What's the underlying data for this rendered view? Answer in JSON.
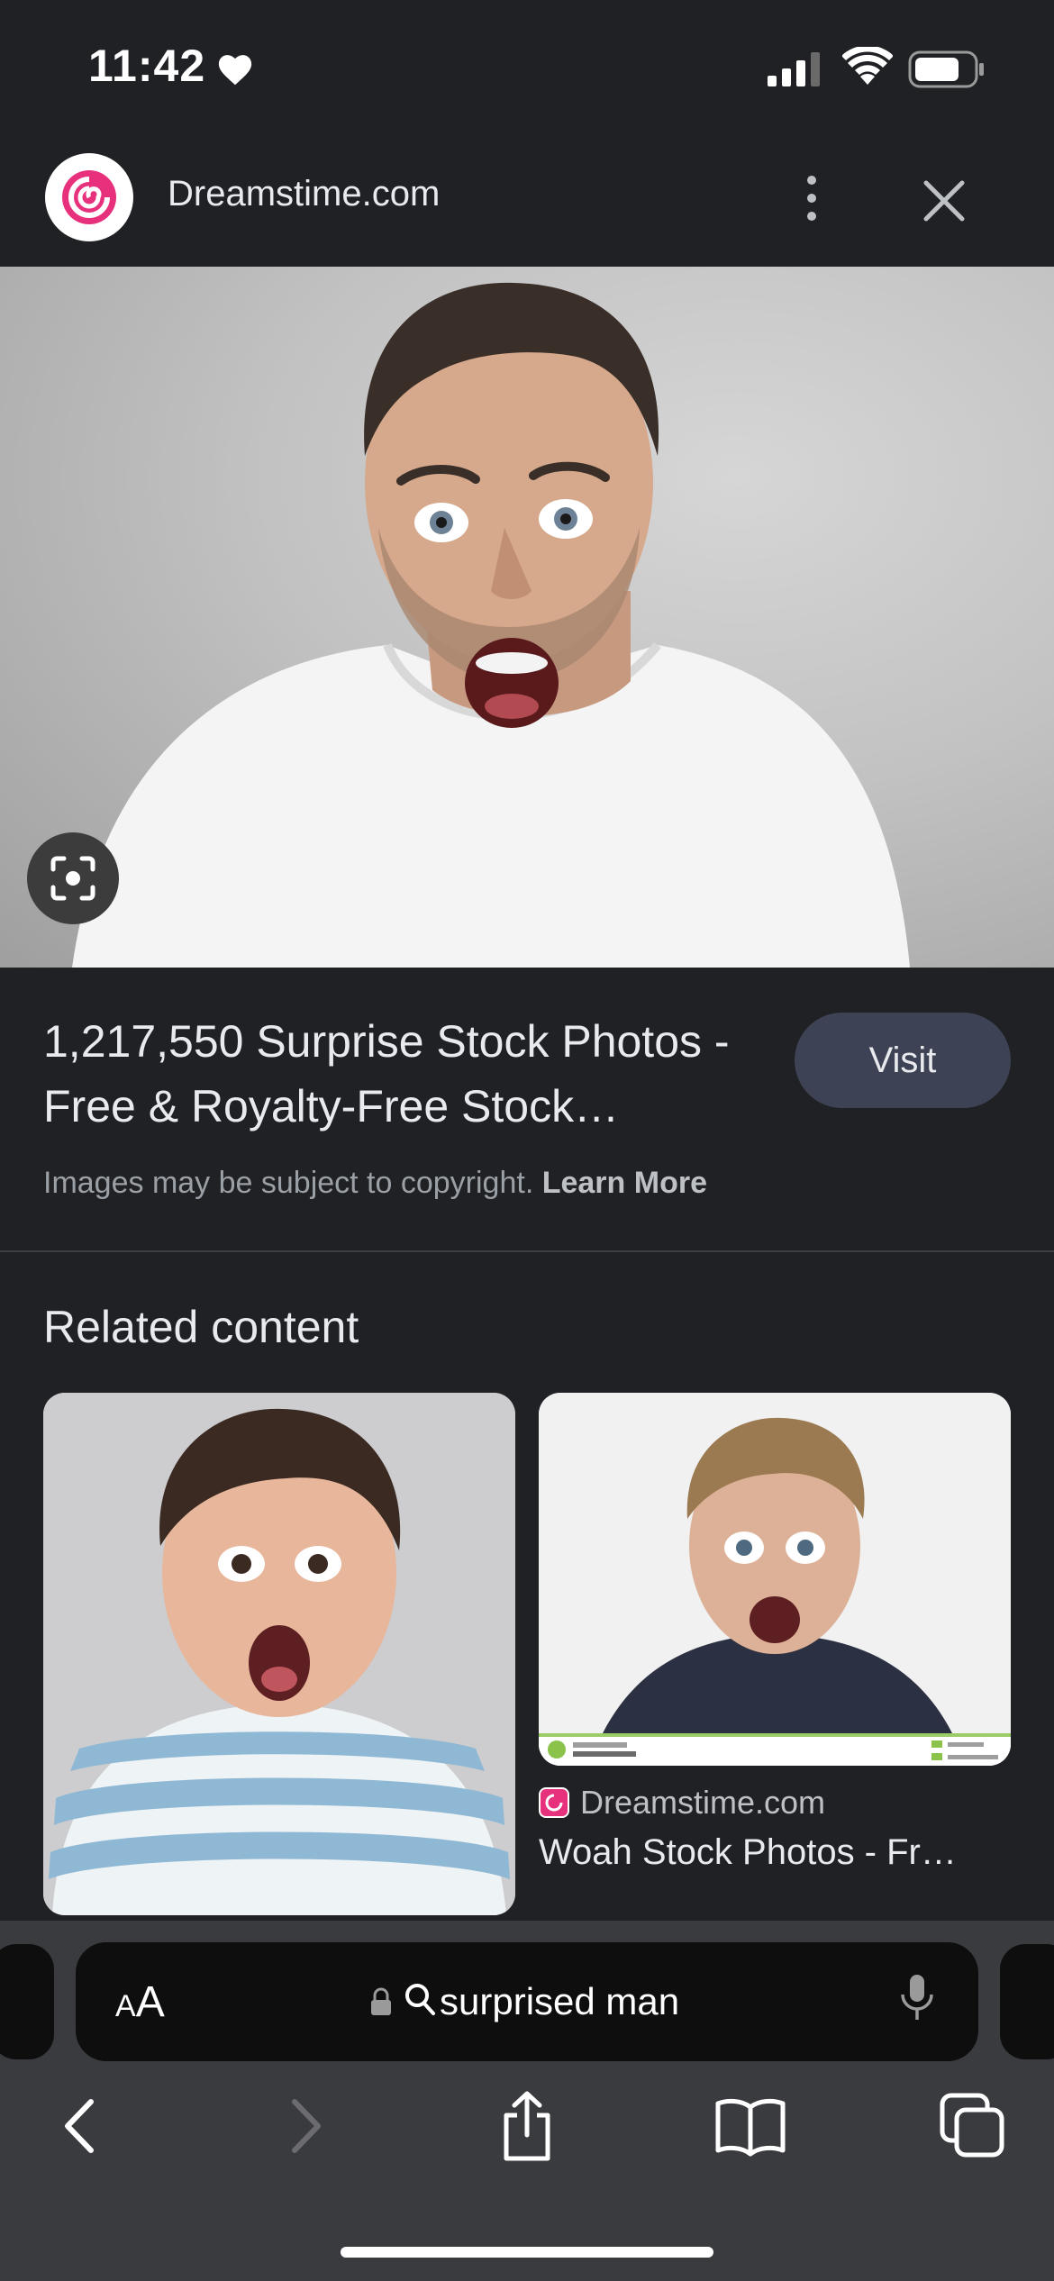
{
  "status": {
    "time": "11:42",
    "heart_icon": "heart-icon",
    "signal_icon": "signal-icon",
    "wifi_icon": "wifi-icon",
    "battery_icon": "battery-icon"
  },
  "header": {
    "site_name": "Dreamstime.com",
    "logo_icon": "dreamstime-logo-icon",
    "more_icon": "more-vert-icon",
    "close_icon": "close-icon"
  },
  "hero": {
    "lens_icon": "google-lens-icon"
  },
  "result": {
    "title": "1,217,550 Surprise Stock Photos - Free & Royalty-Free Stock…",
    "visit_label": "Visit",
    "copyright_text": "Images may be subject to copyright.",
    "learn_more": "Learn More"
  },
  "related": {
    "heading": "Related content",
    "items": [
      {
        "source": "",
        "title": ""
      },
      {
        "source": "Dreamstime.com",
        "title": "Woah Stock Photos - Fr…"
      }
    ]
  },
  "browser": {
    "text_size_small": "A",
    "text_size_large": "A",
    "address": "surprised man",
    "lock_icon": "lock-icon",
    "search_icon": "search-icon",
    "mic_icon": "microphone-icon",
    "toolbar": [
      "back-icon",
      "forward-icon",
      "share-icon",
      "bookmarks-icon",
      "tabs-icon"
    ]
  },
  "colors": {
    "background": "#202124",
    "visit_button": "#3d4354",
    "toolbar": "#3a3b3e",
    "address_bar": "#0e0e0f",
    "brand_pink": "#e8317d"
  }
}
